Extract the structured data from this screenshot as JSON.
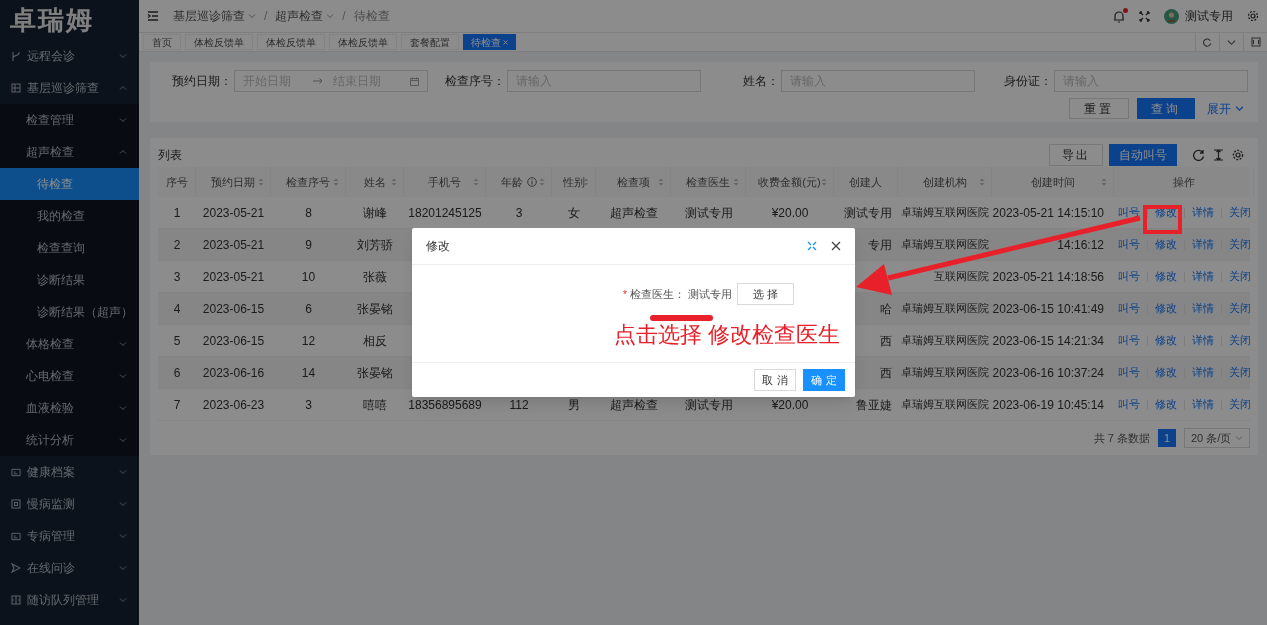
{
  "logo": "卓瑞姆",
  "sidebar": {
    "items": [
      {
        "label": "远程会诊",
        "expanded": false
      },
      {
        "label": "基层巡诊筛查",
        "expanded": true,
        "children": [
          {
            "label": "检查管理",
            "expanded": false
          },
          {
            "label": "超声检查",
            "expanded": true,
            "children": [
              {
                "label": "待检查",
                "selected": true
              },
              {
                "label": "我的检查",
                "selected": false
              },
              {
                "label": "检查查询",
                "selected": false
              },
              {
                "label": "诊断结果",
                "selected": false
              },
              {
                "label": "诊断结果（超声）",
                "selected": false
              }
            ]
          },
          {
            "label": "体格检查",
            "expanded": false
          },
          {
            "label": "心电检查",
            "expanded": false
          },
          {
            "label": "血液检验",
            "expanded": false
          },
          {
            "label": "统计分析",
            "expanded": false
          }
        ]
      },
      {
        "label": "健康档案",
        "expanded": false
      },
      {
        "label": "慢病监测",
        "expanded": false
      },
      {
        "label": "专病管理",
        "expanded": false
      },
      {
        "label": "在线问诊",
        "expanded": false
      },
      {
        "label": "随访队列管理",
        "expanded": false
      }
    ]
  },
  "breadcrumb": [
    {
      "label": "基层巡诊筛查",
      "dropdown": true
    },
    {
      "separator": "/",
      "label": "超声检查",
      "dropdown": true
    },
    {
      "separator": "/",
      "label": "待检查",
      "dropdown": false
    }
  ],
  "user": {
    "name": "测试专用",
    "unread": true
  },
  "tabs": [
    {
      "label": "首页",
      "selected": false,
      "closable": false
    },
    {
      "label": "体检反馈单",
      "selected": false,
      "closable": false
    },
    {
      "label": "体检反馈单",
      "selected": false,
      "closable": false
    },
    {
      "label": "体检反馈单",
      "selected": false,
      "closable": false
    },
    {
      "label": "套餐配置",
      "selected": false,
      "closable": false
    },
    {
      "label": "待检查",
      "selected": true,
      "closable": true
    }
  ],
  "filters": [
    {
      "kind": "date_range",
      "label": "预约日期：",
      "start_placeholder": "开始日期",
      "end_placeholder": "结束日期"
    },
    {
      "kind": "text",
      "label": "检查序号：",
      "placeholder": "请输入"
    },
    {
      "kind": "text",
      "label": "姓名：",
      "placeholder": "请输入"
    },
    {
      "kind": "text",
      "label": "身份证：",
      "placeholder": "请输入"
    }
  ],
  "filter_actions": {
    "reset": "重置",
    "search": "查询",
    "expand": "展开"
  },
  "list": {
    "title": "列表",
    "export": "导出",
    "auto_call": "自动叫号"
  },
  "table": {
    "columns": [
      {
        "label": "序号",
        "sortable": false,
        "info": false
      },
      {
        "label": "预约日期",
        "sortable": true,
        "info": false
      },
      {
        "label": "检查序号",
        "sortable": true,
        "info": false
      },
      {
        "label": "姓名",
        "sortable": true,
        "info": false
      },
      {
        "label": "手机号",
        "sortable": true,
        "info": false
      },
      {
        "label": "年龄",
        "sortable": true,
        "info": true
      },
      {
        "label": "性别",
        "sortable": true,
        "info": false
      },
      {
        "label": "检查项",
        "sortable": true,
        "info": false
      },
      {
        "label": "检查医生",
        "sortable": true,
        "info": false
      },
      {
        "label": "收费金额(元)",
        "sortable": true,
        "info": false
      },
      {
        "label": "创建人",
        "sortable": false,
        "info": false
      },
      {
        "label": "创建机构",
        "sortable": true,
        "info": false
      },
      {
        "label": "创建时间",
        "sortable": true,
        "info": false
      },
      {
        "label": "操作",
        "sortable": false,
        "info": false
      }
    ],
    "rows": [
      {
        "no": "1",
        "date": "2023-05-21",
        "exam_no": "8",
        "name": "谢峰",
        "phone": "18201245125",
        "age": "3",
        "sex": "女",
        "item": "超声检查",
        "doctor": "测试专用",
        "fee": "¥20.00",
        "creator": "测试专用",
        "org": "卓瑞姆互联网医院",
        "created": "2023-05-21 14:15:10",
        "actions": [
          "叫号",
          "修改",
          "详情",
          "关闭"
        ]
      },
      {
        "no": "2",
        "date": "2023-05-21",
        "exam_no": "9",
        "name": "刘芳骄",
        "creator": "专用",
        "org": "卓瑞姆互联网医院",
        "created": "14:16:12",
        "actions": [
          "叫号",
          "修改",
          "详情",
          "关闭"
        ]
      },
      {
        "no": "3",
        "date": "2023-05-21",
        "exam_no": "10",
        "name": "张薇",
        "org": "互联网医院",
        "created": "2023-05-21 14:18:56",
        "actions": [
          "叫号",
          "修改",
          "详情",
          "关闭"
        ]
      },
      {
        "no": "4",
        "date": "2023-06-15",
        "exam_no": "6",
        "name": "张晏铭",
        "creator": "哈",
        "org": "卓瑞姆互联网医院",
        "created": "2023-06-15 10:41:49",
        "actions": [
          "叫号",
          "修改",
          "详情",
          "关闭"
        ]
      },
      {
        "no": "5",
        "date": "2023-06-15",
        "exam_no": "12",
        "name": "相反",
        "creator": "西",
        "org": "卓瑞姆互联网医院",
        "created": "2023-06-15 14:21:34",
        "actions": [
          "叫号",
          "修改",
          "详情",
          "关闭"
        ]
      },
      {
        "no": "6",
        "date": "2023-06-16",
        "exam_no": "14",
        "name": "张晏铭",
        "creator": "西",
        "org": "卓瑞姆互联网医院",
        "created": "2023-06-16 10:37:24",
        "actions": [
          "叫号",
          "修改",
          "详情",
          "关闭"
        ]
      },
      {
        "no": "7",
        "date": "2023-06-23",
        "exam_no": "3",
        "name": "嘻嘻",
        "phone": "18356895689",
        "age": "112",
        "sex": "男",
        "item": "超声检查",
        "doctor": "测试专用",
        "fee": "¥20.00",
        "creator": "鲁亚婕",
        "org": "卓瑞姆互联网医院",
        "created": "2023-06-19 10:45:14",
        "actions": [
          "叫号",
          "修改",
          "详情",
          "关闭"
        ]
      }
    ]
  },
  "pagination": {
    "total": "共 7 条数据",
    "pages": [
      {
        "label": "1",
        "selected": true
      }
    ],
    "page_size": "20 条/页"
  },
  "modal": {
    "title": "修改",
    "field": {
      "required_mark": "*",
      "label": "检查医生：",
      "value": "测试专用"
    },
    "select_button": "选 择",
    "cancel": "取 消",
    "ok": "确 定"
  },
  "annotation": {
    "text": "点击选择 修改检查医生"
  }
}
